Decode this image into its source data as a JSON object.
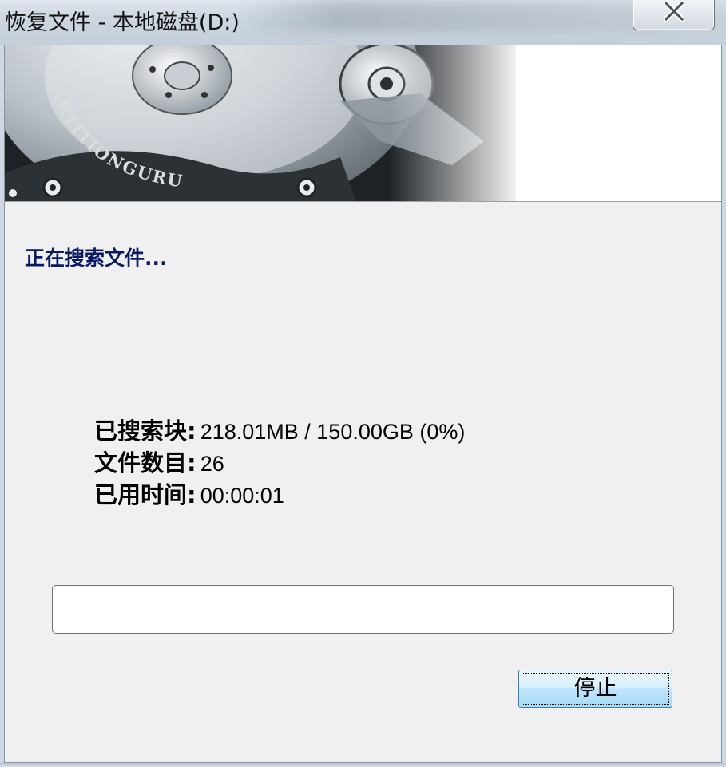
{
  "window": {
    "title": "恢复文件 - 本地磁盘(D:)",
    "close_icon": "close-icon"
  },
  "banner": {
    "logo_text": "PARTITIONGURU",
    "image": "hard-disk-platter-illustration"
  },
  "status": {
    "heading": "正在搜索文件..."
  },
  "stats": [
    {
      "label": "已搜索块:",
      "value": "218.01MB / 150.00GB (0%)"
    },
    {
      "label": "文件数目:",
      "value": "26"
    },
    {
      "label": "已用时间:",
      "value": "00:00:01"
    }
  ],
  "progress": {
    "fraction": 0.0
  },
  "buttons": {
    "stop_label": "停止"
  },
  "colors": {
    "heading": "#0a1a66",
    "button_accent": "#3c7fb1",
    "client_bg": "#f0f0f0"
  }
}
